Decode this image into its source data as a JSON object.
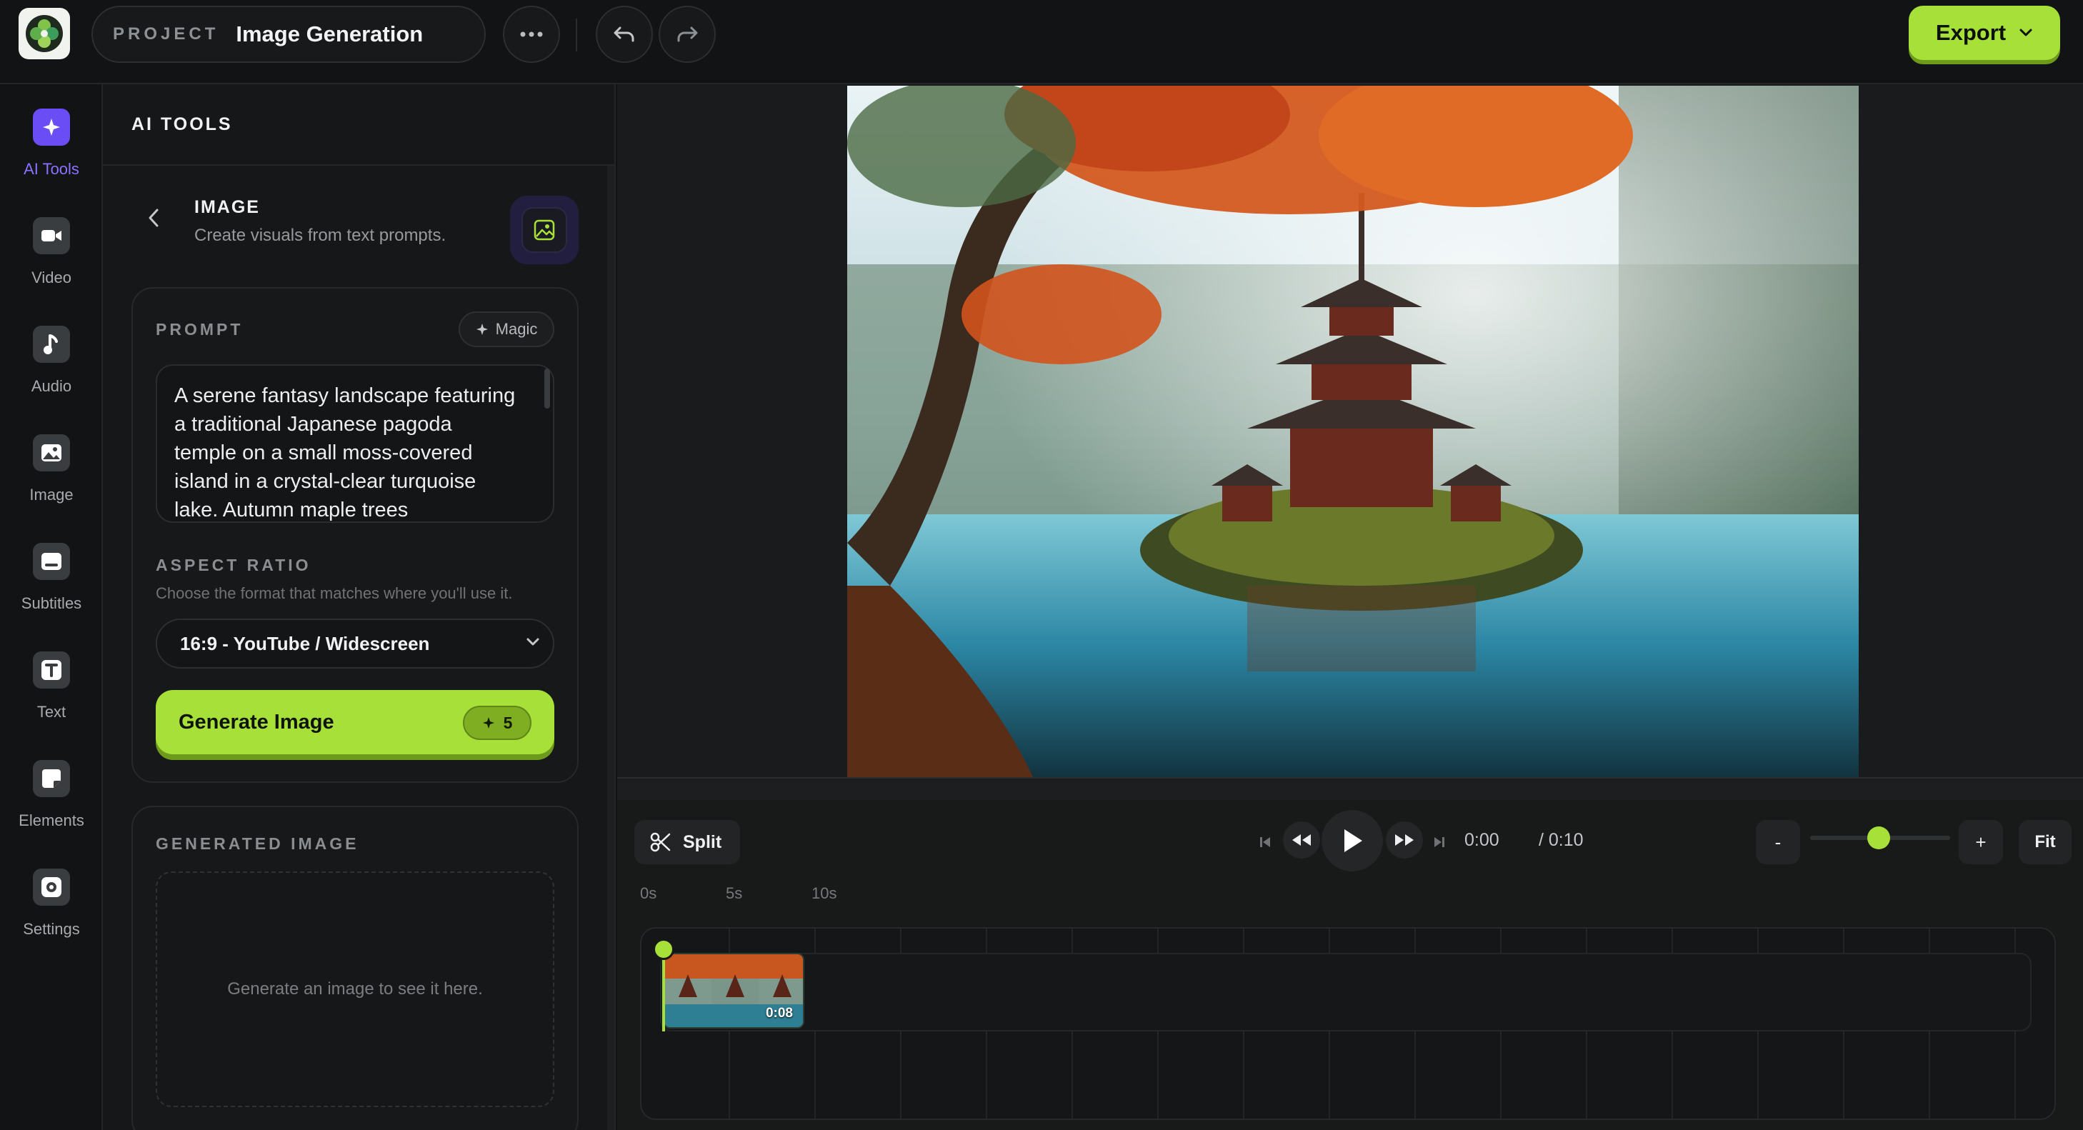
{
  "header": {
    "project_label": "PROJECT",
    "project_name": "Image Generation",
    "export_label": "Export"
  },
  "nav": {
    "items": [
      {
        "label": "AI Tools",
        "icon": "sparkle-icon",
        "active": true
      },
      {
        "label": "Video",
        "icon": "video-icon"
      },
      {
        "label": "Audio",
        "icon": "music-note-icon"
      },
      {
        "label": "Image",
        "icon": "image-icon"
      },
      {
        "label": "Subtitles",
        "icon": "subtitles-icon"
      },
      {
        "label": "Text",
        "icon": "text-icon"
      },
      {
        "label": "Elements",
        "icon": "elements-icon"
      },
      {
        "label": "Settings",
        "icon": "gear-icon"
      }
    ]
  },
  "panel": {
    "title": "AI TOOLS",
    "tool_title": "IMAGE",
    "tool_subtitle": "Create visuals from text prompts.",
    "prompt_label": "PROMPT",
    "magic_label": "Magic",
    "prompt_text": "A serene fantasy landscape featuring a traditional Japanese pagoda temple on a small moss-covered island in a crystal-clear turquoise lake. Autumn maple trees",
    "aspect_label": "ASPECT RATIO",
    "aspect_hint": "Choose the format that matches where you'll use it.",
    "aspect_value": "16:9 - YouTube / Widescreen",
    "generate_label": "Generate Image",
    "generate_cost": "5",
    "generated_label": "GENERATED IMAGE",
    "generated_placeholder": "Generate an image to see it here."
  },
  "timeline": {
    "split_label": "Split",
    "time_current": "0:00",
    "time_total": "/ 0:10",
    "zoom_out": "-",
    "zoom_in": "+",
    "fit_label": "Fit",
    "zoom_level": 0.42,
    "ruler": [
      "0s",
      "5s",
      "10s"
    ],
    "clip_duration": "0:08"
  },
  "colors": {
    "accent_green": "#a8e03a",
    "accent_purple": "#6a4df4",
    "background": "#121314"
  }
}
